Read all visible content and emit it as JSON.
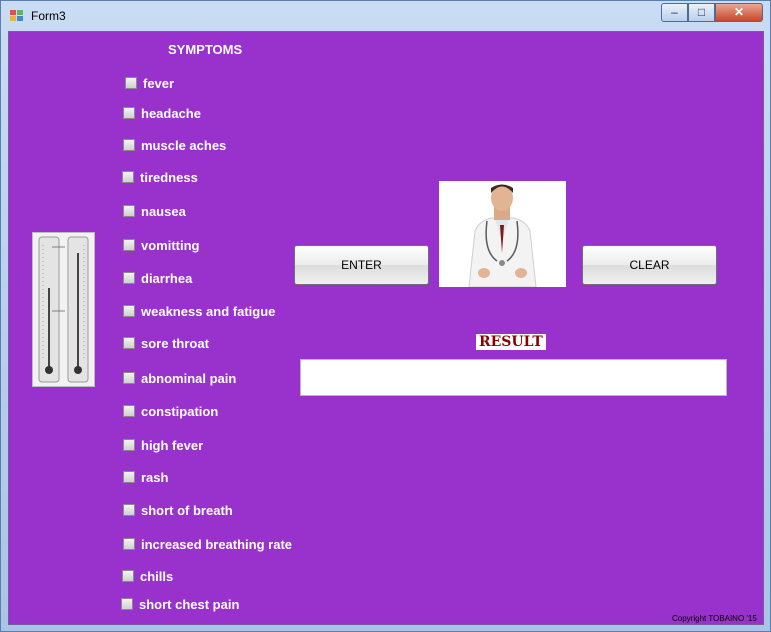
{
  "window": {
    "title": "Form3"
  },
  "symptoms": {
    "heading": "SYMPTOMS",
    "items": [
      "fever",
      "headache",
      "muscle aches",
      "tiredness",
      "nausea",
      "vomitting",
      "diarrhea",
      "weakness and fatigue",
      "sore throat",
      "abnominal pain",
      "constipation",
      "high fever",
      "rash",
      "short of breath",
      "increased breathing rate",
      "chills",
      "short chest pain"
    ]
  },
  "buttons": {
    "enter": "ENTER",
    "clear": "CLEAR"
  },
  "result": {
    "label": "RESULT",
    "value": ""
  },
  "footer": {
    "copyright": "Copyright TOBAINO '15"
  },
  "colors": {
    "background": "#9932cc",
    "result_label": "#8b0000"
  }
}
